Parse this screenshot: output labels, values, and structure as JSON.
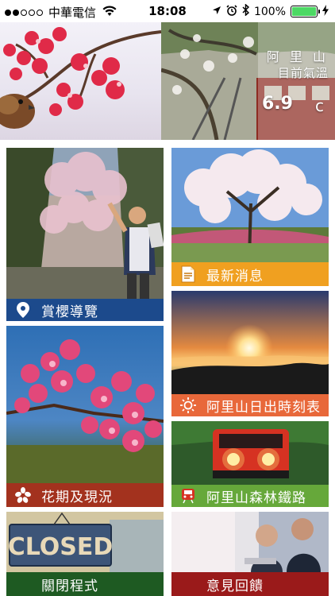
{
  "status_bar": {
    "signal_dots": [
      "full",
      "full",
      "empty",
      "empty",
      "empty"
    ],
    "carrier": "中華電信",
    "time": "18:08",
    "battery": "100%",
    "battery_level": 1.0,
    "battery_color": "#4cd964"
  },
  "banner": {
    "weather_title": "阿 里 山",
    "weather_subtitle": "目前氣溫",
    "temperature": "6.9",
    "unit": "c"
  },
  "tiles": {
    "guide": {
      "label": "賞櫻導覽",
      "icon": "location-pin-icon",
      "color": "#1c4a8c"
    },
    "news": {
      "label": "最新消息",
      "icon": "document-icon",
      "color": "#f0a020"
    },
    "sunrise": {
      "label": "阿里山日出時刻表",
      "icon": "sun-icon",
      "color": "#e8683a"
    },
    "bloom": {
      "label": "花期及現況",
      "icon": "flower-icon",
      "color": "#a3321e"
    },
    "railway": {
      "label": "阿里山森林鐵路",
      "icon": "train-icon",
      "color": "#66a83a"
    },
    "close": {
      "label": "關閉程式",
      "icon": "closed-sign-icon",
      "color": "#1e5a22"
    },
    "feedback": {
      "label": "意見回饋",
      "icon": "business-people-icon",
      "color": "#9a1a1a"
    }
  },
  "closed_sign": "CLOSED"
}
